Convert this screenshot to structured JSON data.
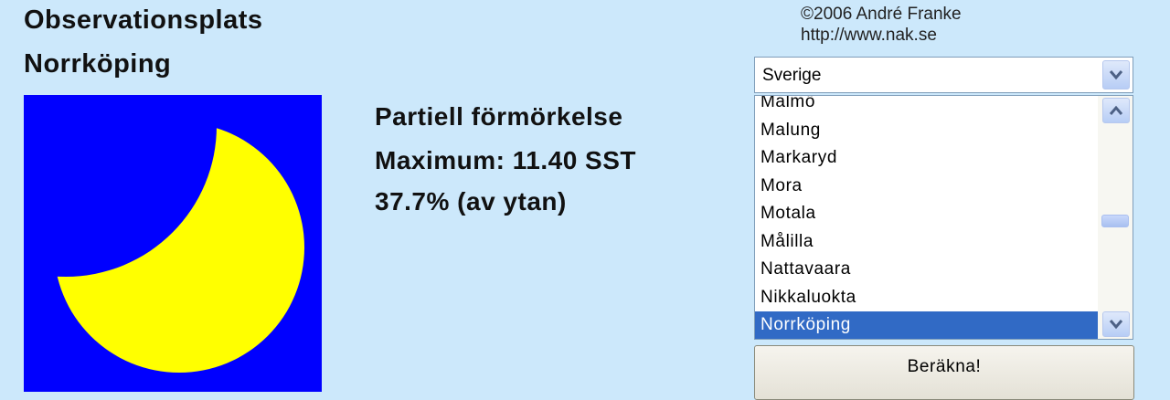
{
  "location": {
    "label": "Observationsplats",
    "city": "Norrköping"
  },
  "eclipse": {
    "type": "Partiell förmörkelse",
    "maximum": "Maximum: 11.40 SST",
    "coverage_value": "37.7%",
    "coverage_suffix": " (av ytan)",
    "coverage_fraction": 0.377,
    "colors": {
      "sky": "#0000ff",
      "sun": "#ffff00"
    }
  },
  "credit": {
    "copyright": "©2006 André Franke",
    "url": "http://www.nak.se"
  },
  "country_select": {
    "value": "Sverige",
    "icon": "chevron-down-icon"
  },
  "city_list": {
    "items": [
      "Malmö",
      "Malung",
      "Markaryd",
      "Mora",
      "Motala",
      "Målilla",
      "Nattavaara",
      "Nikkaluokta",
      "Norrköping"
    ],
    "selected_index": 8,
    "scroll_position": 0.52,
    "selection_color": "#316ac5"
  },
  "actions": {
    "calculate_label": "Beräkna!"
  }
}
